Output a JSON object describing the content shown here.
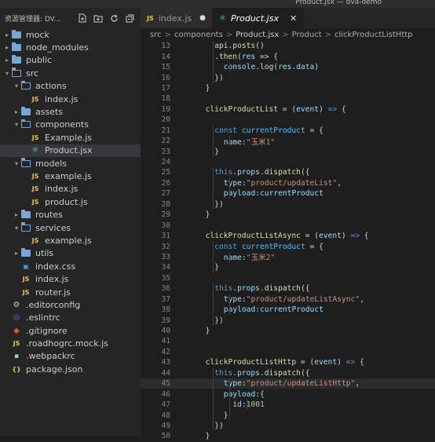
{
  "window": {
    "title": "Product.jsx — dva-demo"
  },
  "explorer": {
    "title": "资源管理器: DV...",
    "actions": [
      "new-file-icon",
      "new-folder-icon",
      "refresh-icon",
      "collapse-icon"
    ],
    "items": [
      {
        "label": "mock",
        "type": "folder",
        "depth": 0,
        "open": false
      },
      {
        "label": "node_modules",
        "type": "folder",
        "depth": 0,
        "open": false
      },
      {
        "label": "public",
        "type": "folder",
        "depth": 0,
        "open": false
      },
      {
        "label": "src",
        "type": "folder",
        "depth": 0,
        "open": true
      },
      {
        "label": "actions",
        "type": "folder",
        "depth": 1,
        "open": true
      },
      {
        "label": "index.js",
        "type": "js",
        "depth": 2
      },
      {
        "label": "assets",
        "type": "folder",
        "depth": 1,
        "open": false
      },
      {
        "label": "components",
        "type": "folder",
        "depth": 1,
        "open": true
      },
      {
        "label": "Example.js",
        "type": "js",
        "depth": 2
      },
      {
        "label": "Product.jsx",
        "type": "react",
        "depth": 2,
        "selected": true
      },
      {
        "label": "models",
        "type": "folder",
        "depth": 1,
        "open": true
      },
      {
        "label": "example.js",
        "type": "js",
        "depth": 2
      },
      {
        "label": "index.js",
        "type": "js",
        "depth": 2
      },
      {
        "label": "product.js",
        "type": "js",
        "depth": 2
      },
      {
        "label": "routes",
        "type": "folder",
        "depth": 1,
        "open": false
      },
      {
        "label": "services",
        "type": "folder",
        "depth": 1,
        "open": true
      },
      {
        "label": "example.js",
        "type": "js",
        "depth": 2
      },
      {
        "label": "utils",
        "type": "folder",
        "depth": 1,
        "open": false
      },
      {
        "label": "index.css",
        "type": "css",
        "depth": 1
      },
      {
        "label": "index.js",
        "type": "js",
        "depth": 1
      },
      {
        "label": "router.js",
        "type": "js",
        "depth": 1
      },
      {
        "label": ".editorconfig",
        "type": "gear",
        "depth": 0
      },
      {
        "label": ".eslintrc",
        "type": "eslint",
        "depth": 0
      },
      {
        "label": ".gitignore",
        "type": "git",
        "depth": 0
      },
      {
        "label": ".roadhogrc.mock.js",
        "type": "js",
        "depth": 0
      },
      {
        "label": ".webpackrc",
        "type": "webpack",
        "depth": 0
      },
      {
        "label": "package.json",
        "type": "json",
        "depth": 0
      }
    ]
  },
  "tabs": [
    {
      "label": "index.js",
      "icon": "JS",
      "modified": true,
      "active": false
    },
    {
      "label": "Product.jsx",
      "icon": "react",
      "modified": false,
      "active": true
    }
  ],
  "breadcrumb": [
    "src",
    ">",
    "components",
    ">",
    "Product.jsx",
    ">",
    "Product",
    ">",
    "clickProductListHttp"
  ],
  "code": [
    {
      "n": "13",
      "indent": 2,
      "tokens": [
        [
          "pl",
          "api."
        ],
        [
          "fn",
          "posts"
        ],
        [
          "pl",
          "()"
        ]
      ]
    },
    {
      "n": "14",
      "indent": 2,
      "tokens": [
        [
          "pl",
          "."
        ],
        [
          "fn",
          "then"
        ],
        [
          "pl",
          "("
        ],
        [
          "prop",
          "res"
        ],
        [
          "pl",
          " => {"
        ]
      ]
    },
    {
      "n": "15",
      "indent": 3,
      "tokens": [
        [
          "prop",
          "console"
        ],
        [
          "pl",
          "."
        ],
        [
          "fn",
          "log"
        ],
        [
          "pl",
          "("
        ],
        [
          "prop",
          "res"
        ],
        [
          "pl",
          "."
        ],
        [
          "prop",
          "data"
        ],
        [
          "pl",
          ")"
        ]
      ]
    },
    {
      "n": "16",
      "indent": 2,
      "tokens": [
        [
          "pl",
          "})"
        ]
      ]
    },
    {
      "n": "17",
      "indent": 1,
      "tokens": [
        [
          "pl",
          "}"
        ]
      ]
    },
    {
      "n": "18",
      "indent": 0,
      "tokens": []
    },
    {
      "n": "19",
      "indent": 1,
      "tokens": [
        [
          "fn",
          "clickProductList"
        ],
        [
          "pl",
          " = ("
        ],
        [
          "prop",
          "event"
        ],
        [
          "pl",
          ") "
        ],
        [
          "kw",
          "=>"
        ],
        [
          "pl",
          " {"
        ]
      ]
    },
    {
      "n": "20",
      "indent": 0,
      "tokens": []
    },
    {
      "n": "21",
      "indent": 2,
      "tokens": [
        [
          "kw",
          "const"
        ],
        [
          "pl",
          " "
        ],
        [
          "var",
          "currentProduct"
        ],
        [
          "pl",
          " = {"
        ]
      ]
    },
    {
      "n": "22",
      "indent": 3,
      "tokens": [
        [
          "prop",
          "name"
        ],
        [
          "pl",
          ":"
        ],
        [
          "str",
          "\"玉米1\""
        ]
      ]
    },
    {
      "n": "23",
      "indent": 2,
      "tokens": [
        [
          "pl",
          "}"
        ]
      ]
    },
    {
      "n": "24",
      "indent": 0,
      "tokens": []
    },
    {
      "n": "25",
      "indent": 2,
      "tokens": [
        [
          "kw",
          "this"
        ],
        [
          "pl",
          "."
        ],
        [
          "prop",
          "props"
        ],
        [
          "pl",
          "."
        ],
        [
          "fn",
          "dispatch"
        ],
        [
          "pl",
          "({"
        ]
      ]
    },
    {
      "n": "26",
      "indent": 3,
      "tokens": [
        [
          "prop",
          "type"
        ],
        [
          "pl",
          ":"
        ],
        [
          "str",
          "\"product/updateList\""
        ],
        [
          "pl",
          ","
        ]
      ]
    },
    {
      "n": "27",
      "indent": 3,
      "tokens": [
        [
          "prop",
          "payload"
        ],
        [
          "pl",
          ":"
        ],
        [
          "prop",
          "currentProduct"
        ]
      ]
    },
    {
      "n": "28",
      "indent": 2,
      "tokens": [
        [
          "pl",
          "})"
        ]
      ]
    },
    {
      "n": "29",
      "indent": 1,
      "tokens": [
        [
          "pl",
          "}"
        ]
      ]
    },
    {
      "n": "30",
      "indent": 0,
      "tokens": []
    },
    {
      "n": "31",
      "indent": 1,
      "tokens": [
        [
          "fn",
          "clickProductListAsync"
        ],
        [
          "pl",
          " = ("
        ],
        [
          "prop",
          "event"
        ],
        [
          "pl",
          ") "
        ],
        [
          "kw",
          "=>"
        ],
        [
          "pl",
          " {"
        ]
      ]
    },
    {
      "n": "32",
      "indent": 2,
      "tokens": [
        [
          "kw",
          "const"
        ],
        [
          "pl",
          " "
        ],
        [
          "var",
          "currentProduct"
        ],
        [
          "pl",
          " = {"
        ]
      ]
    },
    {
      "n": "33",
      "indent": 3,
      "tokens": [
        [
          "prop",
          "name"
        ],
        [
          "pl",
          ":"
        ],
        [
          "str",
          "\"玉米2\""
        ]
      ]
    },
    {
      "n": "34",
      "indent": 2,
      "tokens": [
        [
          "pl",
          "}"
        ]
      ]
    },
    {
      "n": "35",
      "indent": 0,
      "tokens": []
    },
    {
      "n": "36",
      "indent": 2,
      "tokens": [
        [
          "kw",
          "this"
        ],
        [
          "pl",
          "."
        ],
        [
          "prop",
          "props"
        ],
        [
          "pl",
          "."
        ],
        [
          "fn",
          "dispatch"
        ],
        [
          "pl",
          "({"
        ]
      ]
    },
    {
      "n": "37",
      "indent": 3,
      "tokens": [
        [
          "prop",
          "type"
        ],
        [
          "pl",
          ":"
        ],
        [
          "str",
          "\"product/updateListAsync\""
        ],
        [
          "pl",
          ","
        ]
      ]
    },
    {
      "n": "38",
      "indent": 3,
      "tokens": [
        [
          "prop",
          "payload"
        ],
        [
          "pl",
          ":"
        ],
        [
          "prop",
          "currentProduct"
        ]
      ]
    },
    {
      "n": "39",
      "indent": 2,
      "tokens": [
        [
          "pl",
          "})"
        ]
      ]
    },
    {
      "n": "40",
      "indent": 1,
      "tokens": [
        [
          "pl",
          "}"
        ]
      ]
    },
    {
      "n": "41",
      "indent": 0,
      "tokens": []
    },
    {
      "n": "42",
      "indent": 0,
      "tokens": []
    },
    {
      "n": "43",
      "indent": 1,
      "tokens": [
        [
          "fn",
          "clickProductListHttp"
        ],
        [
          "pl",
          " = ("
        ],
        [
          "prop",
          "event"
        ],
        [
          "pl",
          ") "
        ],
        [
          "kw",
          "=>"
        ],
        [
          "pl",
          " {"
        ]
      ]
    },
    {
      "n": "44",
      "indent": 2,
      "tokens": [
        [
          "kw",
          "this"
        ],
        [
          "pl",
          "."
        ],
        [
          "prop",
          "props"
        ],
        [
          "pl",
          "."
        ],
        [
          "fn",
          "dispatch"
        ],
        [
          "pl",
          "({"
        ]
      ]
    },
    {
      "n": "45",
      "indent": 3,
      "tokens": [
        [
          "prop",
          "type"
        ],
        [
          "pl",
          ":"
        ],
        [
          "str",
          "\"product/updateListHttp\""
        ],
        [
          "pl",
          ","
        ]
      ],
      "highlight": true
    },
    {
      "n": "46",
      "indent": 3,
      "tokens": [
        [
          "prop",
          "payload"
        ],
        [
          "pl",
          ":{"
        ]
      ]
    },
    {
      "n": "47",
      "indent": 4,
      "tokens": [
        [
          "prop",
          "id"
        ],
        [
          "pl",
          ":"
        ],
        [
          "num",
          "1001"
        ]
      ]
    },
    {
      "n": "48",
      "indent": 3,
      "tokens": [
        [
          "pl",
          "}"
        ]
      ]
    },
    {
      "n": "49",
      "indent": 2,
      "tokens": [
        [
          "pl",
          "})"
        ]
      ]
    },
    {
      "n": "50",
      "indent": 1,
      "tokens": [
        [
          "pl",
          "}"
        ]
      ]
    }
  ]
}
